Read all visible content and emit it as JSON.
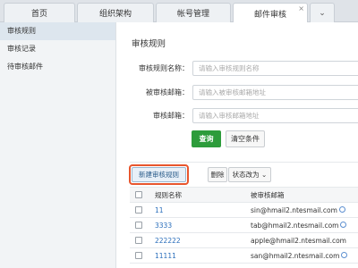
{
  "tabs": [
    {
      "label": "首页"
    },
    {
      "label": "组织架构"
    },
    {
      "label": "帐号管理"
    },
    {
      "label": "邮件审核",
      "active": true
    }
  ],
  "tab_close_glyph": "×",
  "tab_more_glyph": "⌄",
  "sidebar": {
    "items": [
      {
        "label": "审核规则",
        "active": true
      },
      {
        "label": "审核记录"
      },
      {
        "label": "待审核邮件"
      }
    ]
  },
  "main": {
    "title": "审核规则",
    "form": {
      "rule_name_label": "审核规则名称：",
      "rule_name_placeholder": "请输入审核规则名称",
      "audited_mailbox_label": "被审核邮箱：",
      "audited_mailbox_placeholder": "请输入被审核邮箱地址",
      "auditor_mailbox_label": "审核邮箱：",
      "auditor_mailbox_placeholder": "请输入审核邮箱地址",
      "query_button": "查询",
      "clear_button": "清空条件"
    },
    "toolbar": {
      "new_rule_button": "新建审核规则",
      "delete_button": "删除",
      "status_button": "状态改为 ⌄"
    },
    "table": {
      "headers": {
        "name": "规则名称",
        "mailbox": "被审核邮箱"
      },
      "rows": [
        {
          "name": "11",
          "mailbox": "sin@hmail2.ntesmail.com",
          "info": true
        },
        {
          "name": "3333",
          "mailbox": "tab@hmail2.ntesmail.com",
          "info": true
        },
        {
          "name": "222222",
          "mailbox": "apple@hmail2.ntesmail.com",
          "info": false
        },
        {
          "name": "11111",
          "mailbox": "san@hmail2.ntesmail.com",
          "info": true
        }
      ]
    }
  },
  "colors": {
    "primary_button": "#2d9c3b",
    "highlight_ring": "#e8552d",
    "link": "#2a6ebb"
  }
}
